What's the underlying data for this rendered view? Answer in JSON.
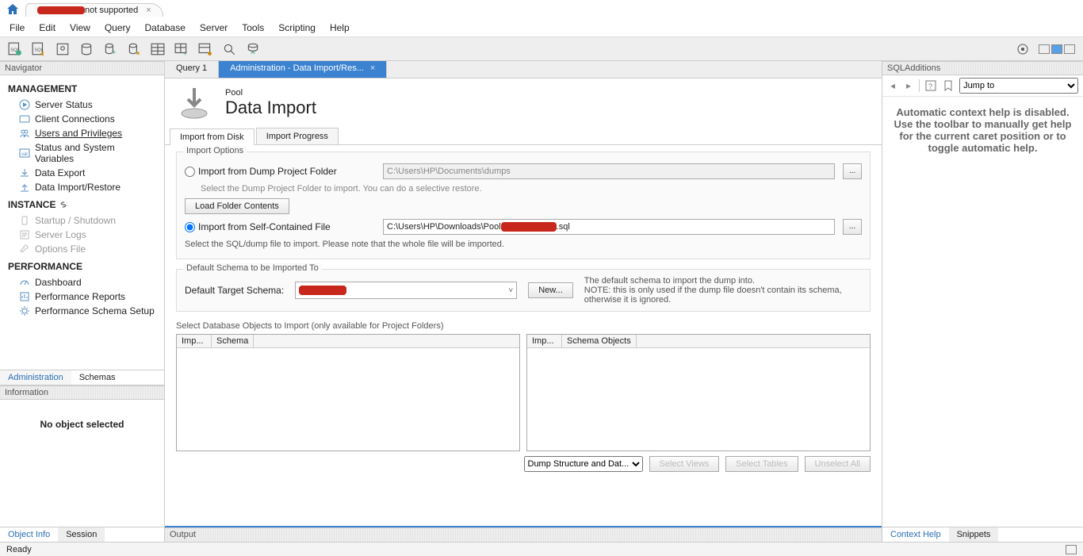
{
  "titlebar": {
    "tab_label_suffix": " not supported"
  },
  "menu": [
    "File",
    "Edit",
    "View",
    "Query",
    "Database",
    "Server",
    "Tools",
    "Scripting",
    "Help"
  ],
  "navigator": {
    "header": "Navigator",
    "management": {
      "title": "MANAGEMENT",
      "items": [
        "Server Status",
        "Client Connections",
        "Users and Privileges",
        "Status and System Variables",
        "Data Export",
        "Data Import/Restore"
      ]
    },
    "instance": {
      "title": "INSTANCE",
      "items": [
        "Startup / Shutdown",
        "Server Logs",
        "Options File"
      ]
    },
    "performance": {
      "title": "PERFORMANCE",
      "items": [
        "Dashboard",
        "Performance Reports",
        "Performance Schema Setup"
      ]
    },
    "tabs": [
      "Administration",
      "Schemas"
    ]
  },
  "information": {
    "header": "Information",
    "body": "No object selected",
    "tabs": [
      "Object Info",
      "Session"
    ]
  },
  "center": {
    "tabs": [
      {
        "label": "Query 1",
        "active": false
      },
      {
        "label": "Administration - Data Import/Res...",
        "active": true
      }
    ],
    "page_small": "Pool",
    "page_big": "Data Import",
    "sub_tabs": [
      "Import from Disk",
      "Import Progress"
    ],
    "import_options": {
      "group": "Import Options",
      "opt1": "Import from Dump Project Folder",
      "opt1_path": "C:\\Users\\HP\\Documents\\dumps",
      "opt1_note": "Select the Dump Project Folder to import. You can do a selective restore.",
      "load_btn": "Load Folder Contents",
      "opt2": "Import from Self-Contained File",
      "opt2_path_prefix": "C:\\Users\\HP\\Downloads\\Pool",
      "opt2_path_suffix": ".sql",
      "opt2_note": "Select the SQL/dump file to import. Please note that the whole file will be imported."
    },
    "schema": {
      "group": "Default Schema to be Imported To",
      "label": "Default Target Schema:",
      "new_btn": "New...",
      "note": "The default schema to import the dump into.\nNOTE: this is only used if the dump file doesn't contain its schema, otherwise it is ignored."
    },
    "objects": {
      "label": "Select Database Objects to Import (only available for Project Folders)",
      "col_imp": "Imp...",
      "col_schema": "Schema",
      "col_objects": "Schema Objects",
      "dump_select": "Dump Structure and Dat...",
      "btns": [
        "Select Views",
        "Select Tables",
        "Unselect All"
      ]
    }
  },
  "output": "Output",
  "right": {
    "header": "SQLAdditions",
    "jump": "Jump to",
    "body": "Automatic context help is disabled. Use the toolbar to manually get help for the current caret position or to toggle automatic help.",
    "tabs": [
      "Context Help",
      "Snippets"
    ]
  },
  "status": "Ready"
}
